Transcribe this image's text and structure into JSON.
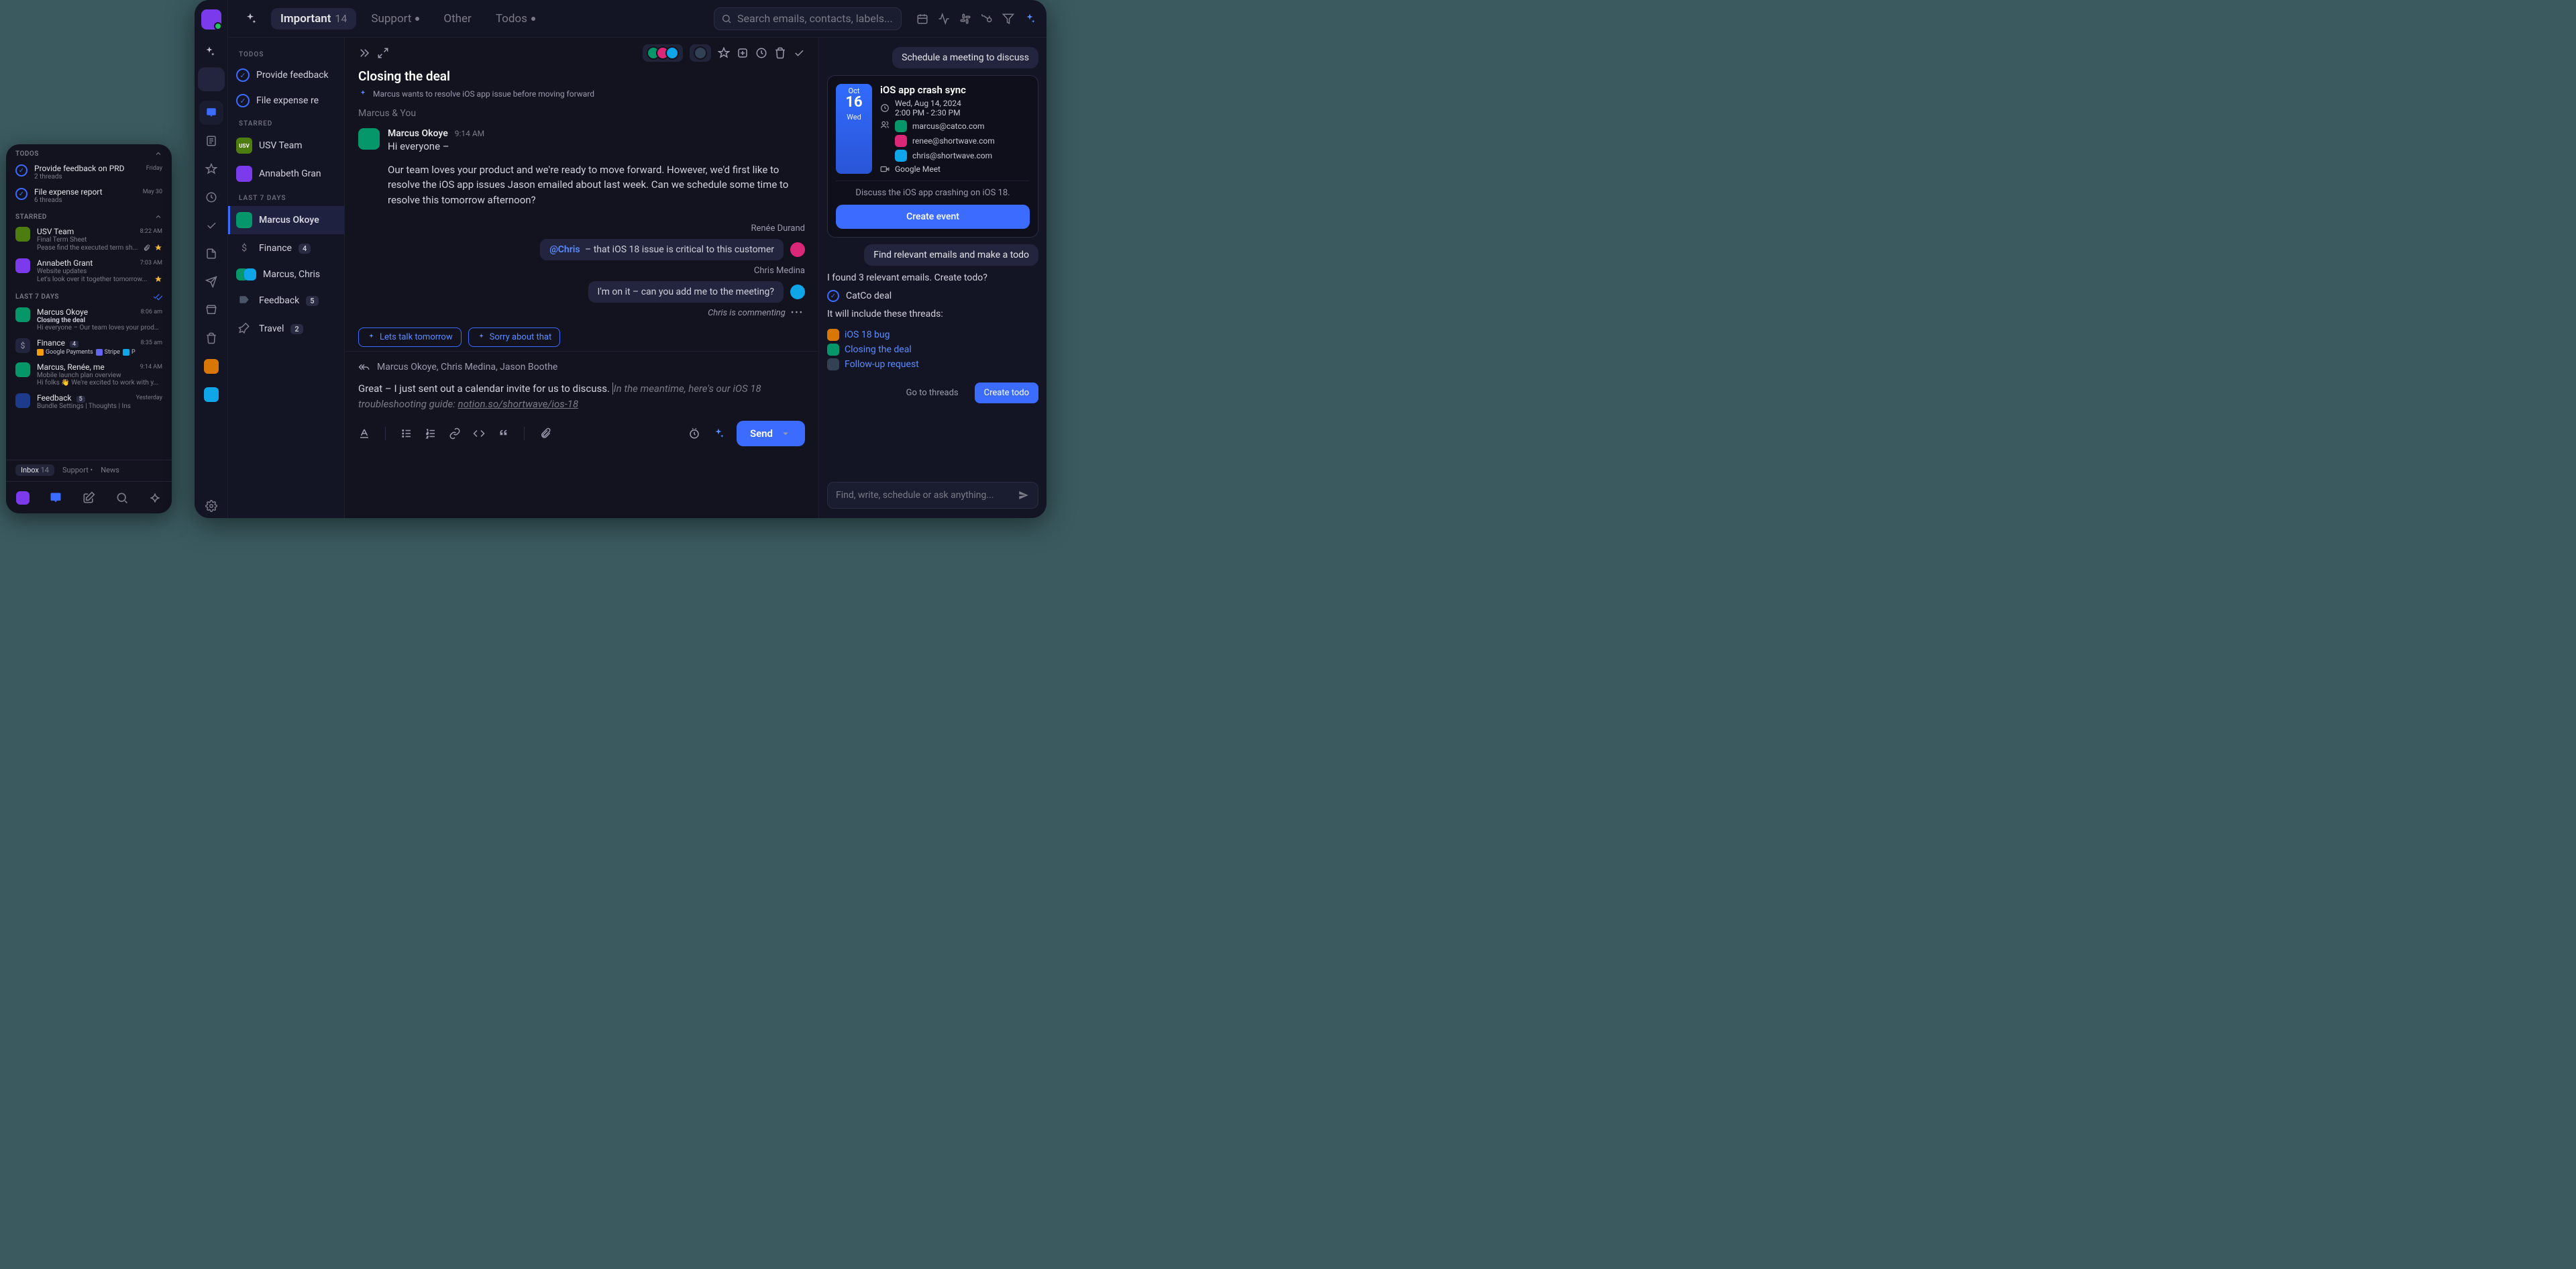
{
  "mobile": {
    "sections": {
      "todos": "TODOS",
      "starred": "STARRED",
      "last7": "LAST 7 DAYS"
    },
    "todos": [
      {
        "title": "Provide feedback on PRD",
        "sub": "2 threads",
        "time": "Friday"
      },
      {
        "title": "File expense report",
        "sub": "6 threads",
        "time": "May 30"
      }
    ],
    "starred": [
      {
        "from": "USV Team",
        "subject": "Final Term Sheet",
        "preview": "Pease find the executed term sh...",
        "time": "8:22 AM",
        "has_attach": true,
        "star": true,
        "avatar": "av-c6"
      },
      {
        "from": "Annabeth Grant",
        "subject": "Website updates",
        "preview": "Let's look over it together tomorrow...",
        "time": "7:03 AM",
        "star": true,
        "avatar": "av-c2"
      }
    ],
    "last7": [
      {
        "from": "Marcus Okoye",
        "subject": "Closing the deal",
        "preview": "Hi everyone – Our team loves your produ...",
        "time": "8:06 am",
        "avatar": "av-c3"
      },
      {
        "from": "Finance",
        "badge": "4",
        "chips": [
          "Google Payments",
          "Stripe",
          "P"
        ],
        "time": "8:35 am"
      },
      {
        "from": "Marcus, Renée, me",
        "subject": "Mobile launch plan overview",
        "preview": "Hi folks 👋 We're excited to work with y...",
        "time": "9:14 AM"
      },
      {
        "from": "Feedback",
        "badge": "5",
        "subject": "Bundle Settings | Thoughts | Ins",
        "time": "Yesterday"
      }
    ],
    "bottom_tabs": {
      "inbox": "Inbox",
      "inbox_count": "14",
      "support": "Support",
      "news": "News"
    }
  },
  "desktop": {
    "tabs": [
      {
        "id": "important",
        "label": "Important",
        "count": "14",
        "active": true
      },
      {
        "id": "support",
        "label": "Support",
        "dot": true
      },
      {
        "id": "other",
        "label": "Other"
      },
      {
        "id": "todos",
        "label": "Todos",
        "dot": true
      }
    ],
    "search_placeholder": "Search emails, contacts, labels...",
    "threadlist": {
      "todos_label": "TODOS",
      "todos": [
        {
          "title": "Provide feedback"
        },
        {
          "title": "File expense re"
        }
      ],
      "starred_label": "STARRED",
      "starred": [
        {
          "label": "USV Team",
          "avatar_text": "USV",
          "avatar": "av-c6"
        },
        {
          "label": "Annabeth Gran",
          "avatar": "av-c2"
        }
      ],
      "last7_label": "LAST 7 DAYS",
      "last7": [
        {
          "label": "Marcus Okoye",
          "avatar": "av-c3",
          "selected": true
        },
        {
          "label": "Finance",
          "badge": "4",
          "icon": "dollar-icon"
        },
        {
          "label": "Marcus, Chris",
          "avatar": "av-c3"
        },
        {
          "label": "Feedback",
          "badge": "5",
          "icon": "tag-icon"
        },
        {
          "label": "Travel",
          "badge": "2",
          "icon": "plane-icon"
        }
      ]
    },
    "conversation": {
      "title": "Closing the deal",
      "ai_summary": "Marcus wants to resolve iOS app issue before moving forward",
      "participants": "Marcus & You",
      "message": {
        "sender": "Marcus Okoye",
        "time": "9:14 AM",
        "line1": "Hi everyone –",
        "para": "Our team loves your product and we're ready to move forward. However, we'd first like to resolve the iOS app issues Jason emailed about last week. Can we schedule some time to resolve this tomorrow afternoon?"
      },
      "comments": [
        {
          "name": "Renée Durand",
          "mention": "@Chris",
          "text": " – that iOS 18 issue is critical to this customer",
          "avatar": "av-c8"
        },
        {
          "name": "Chris Medina",
          "text": "I'm on it – can you add me to the meeting?",
          "avatar": "av-c4"
        }
      ],
      "typing": "Chris is commenting",
      "suggestions": [
        "Lets talk tomorrow",
        "Sorry about that"
      ],
      "compose": {
        "to": "Marcus Okoye, Chris Medina, Jason Boothe",
        "text": "Great – I just sent out a calendar invite for us to discuss. ",
        "ghost1": "In the meantime, here's our iOS 18 troubleshooting guide: ",
        "ghost_link": "notion.so/shortwave/ios-18",
        "send": "Send"
      }
    },
    "ai": {
      "bubble1": "Schedule a meeting to discuss",
      "event": {
        "month": "Oct",
        "day": "16",
        "dow": "Wed",
        "title": "iOS app crash sync",
        "date": "Wed, Aug 14, 2024",
        "time": "2:00 PM - 2:30 PM",
        "attendees": [
          {
            "email": "marcus@catco.com",
            "avatar": "av-c3"
          },
          {
            "email": "renee@shortwave.com",
            "avatar": "av-c8"
          },
          {
            "email": "chris@shortwave.com",
            "avatar": "av-c4"
          }
        ],
        "meet": "Google Meet",
        "desc": "Discuss the iOS app crashing on iOS 18.",
        "create": "Create event"
      },
      "bubble2": "Find relevant emails and make a todo",
      "found": "I found 3 relevant emails. Create todo?",
      "todo_name": "CatCo deal",
      "include_text": "It will include these threads:",
      "threads": [
        {
          "label": "iOS 18 bug",
          "avatar": "av-c1"
        },
        {
          "label": "Closing the deal",
          "avatar": "av-c3"
        },
        {
          "label": "Follow-up request",
          "avatar": "av-c9"
        }
      ],
      "go_to_threads": "Go to threads",
      "create_todo": "Create todo",
      "input_placeholder": "Find, write, schedule or ask anything..."
    }
  }
}
